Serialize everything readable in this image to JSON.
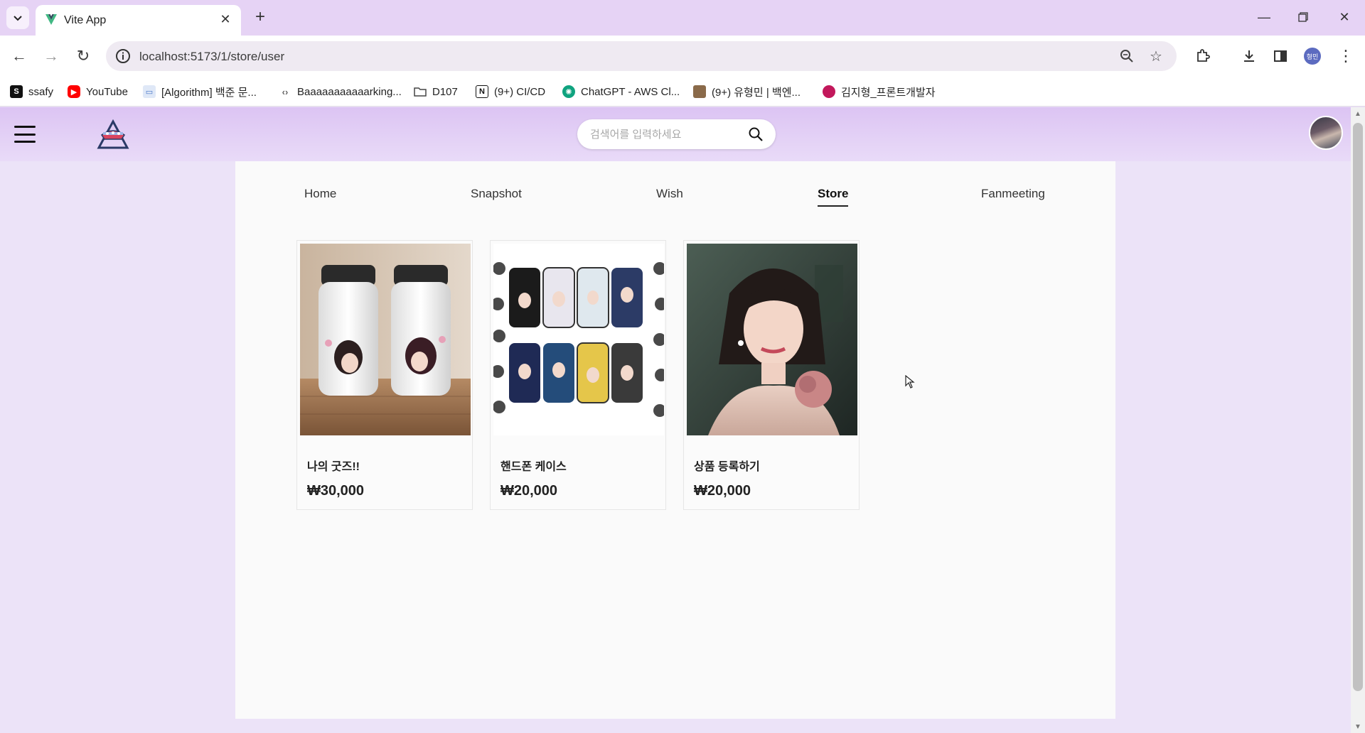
{
  "browser": {
    "tab_title": "Vite App",
    "url": "localhost:5173/1/store/user",
    "profile_label": "형민",
    "bookmarks": [
      {
        "label": "ssafy",
        "icon": "ssafy-icon",
        "color": "#111111"
      },
      {
        "label": "YouTube",
        "icon": "youtube-icon",
        "color": "#ff0000"
      },
      {
        "label": "[Algorithm] 백준 문...",
        "icon": "monitor-icon",
        "color": "#4a78c8"
      },
      {
        "label": "Baaaaaaaaaaarking...",
        "icon": "code-icon",
        "color": "#666666"
      },
      {
        "label": "D107",
        "icon": "folder-icon",
        "color": "#444444"
      },
      {
        "label": "(9+) CI/CD",
        "icon": "notion-icon",
        "color": "#111111"
      },
      {
        "label": "ChatGPT - AWS Cl...",
        "icon": "chatgpt-icon",
        "color": "#10a37f"
      },
      {
        "label": "(9+) 유형민 | 백엔...",
        "icon": "image-icon",
        "color": "#8a6a4a"
      },
      {
        "label": "김지형_프론트개발자",
        "icon": "profile-icon",
        "color": "#c2185b"
      }
    ]
  },
  "app": {
    "search_placeholder": "검색어를 입력하세요",
    "nav": [
      {
        "label": "Home",
        "active": false
      },
      {
        "label": "Snapshot",
        "active": false
      },
      {
        "label": "Wish",
        "active": false
      },
      {
        "label": "Store",
        "active": true
      },
      {
        "label": "Fanmeeting",
        "active": false
      }
    ],
    "products": [
      {
        "name": "나의 굿즈!!",
        "price": "₩30,000",
        "image": "tumbler-photo"
      },
      {
        "name": "핸드폰 케이스",
        "price": "₩20,000",
        "image": "phone-cases-photo"
      },
      {
        "name": "상품 등록하기",
        "price": "₩20,000",
        "image": "portrait-photo"
      }
    ]
  },
  "colors": {
    "header_bg": "#dcc4f3",
    "page_bg": "#ece3f8",
    "content_bg": "#fafafa",
    "tabstrip_bg": "#e6d3f5"
  }
}
